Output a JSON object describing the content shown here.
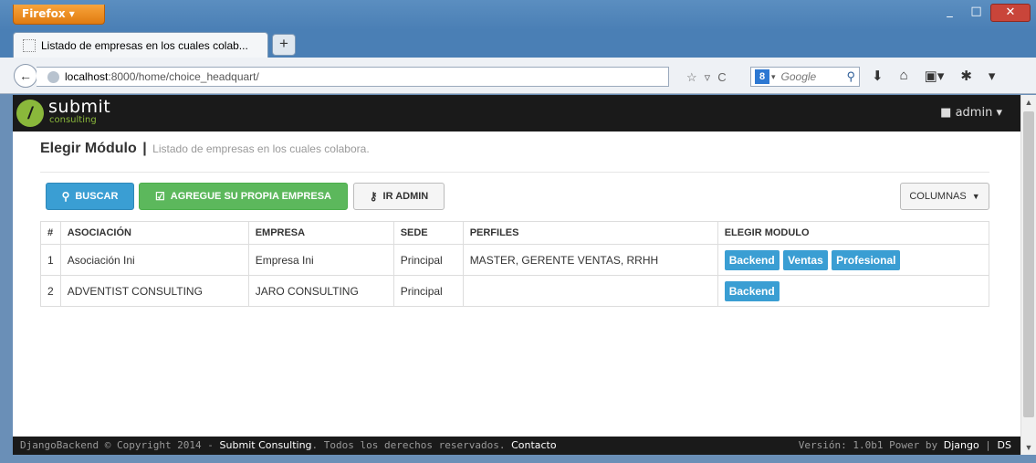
{
  "browser": {
    "menu_button": "Firefox ▾",
    "tab_title": "Listado de empresas en los cuales colab...",
    "new_tab": "+",
    "url_host": "localhost",
    "url_rest": ":8000/home/choice_headquart/",
    "search_engine": "Google",
    "window_controls": {
      "minimize": "_",
      "maximize": "□",
      "close": "✕"
    }
  },
  "header": {
    "logo_mark": "/",
    "logo_text": "submit",
    "logo_sub": "consulting",
    "user": "admin"
  },
  "page": {
    "title": "Elegir Módulo",
    "separator": "|",
    "subtitle": "Listado de empresas en los cuales colabora."
  },
  "toolbar": {
    "buscar": "BUSCAR",
    "agregue": "AGREGUE SU PROPIA EMPRESA",
    "ir_admin": "IR ADMIN",
    "columnas": "COLUMNAS"
  },
  "table": {
    "headers": [
      "#",
      "ASOCIACIÓN",
      "EMPRESA",
      "SEDE",
      "PERFILES",
      "ELEGIR MODULO"
    ],
    "rows": [
      {
        "num": "1",
        "asociacion": "Asociación Ini",
        "empresa": "Empresa Ini",
        "sede": "Principal",
        "perfiles": "MASTER, GERENTE VENTAS, RRHH",
        "modulos": [
          "Backend",
          "Ventas",
          "Profesional"
        ]
      },
      {
        "num": "2",
        "asociacion": "ADVENTIST CONSULTING",
        "empresa": "JARO CONSULTING",
        "sede": "Principal",
        "perfiles": "",
        "modulos": [
          "Backend"
        ]
      }
    ]
  },
  "footer": {
    "prefix": "DjangoBackend © Copyright 2014 - ",
    "company": "Submit Consulting",
    "middle": ". Todos los derechos reservados. ",
    "contact": "Contacto",
    "version": "Versión: 1.0b1 Power by ",
    "django": "Django",
    "pipe": " | ",
    "ds": "DS"
  },
  "colors": {
    "accent": "#3a9ed3",
    "success": "#5cb85c",
    "header_bg": "#1a1a1a",
    "brand_green": "#8ab83b"
  }
}
